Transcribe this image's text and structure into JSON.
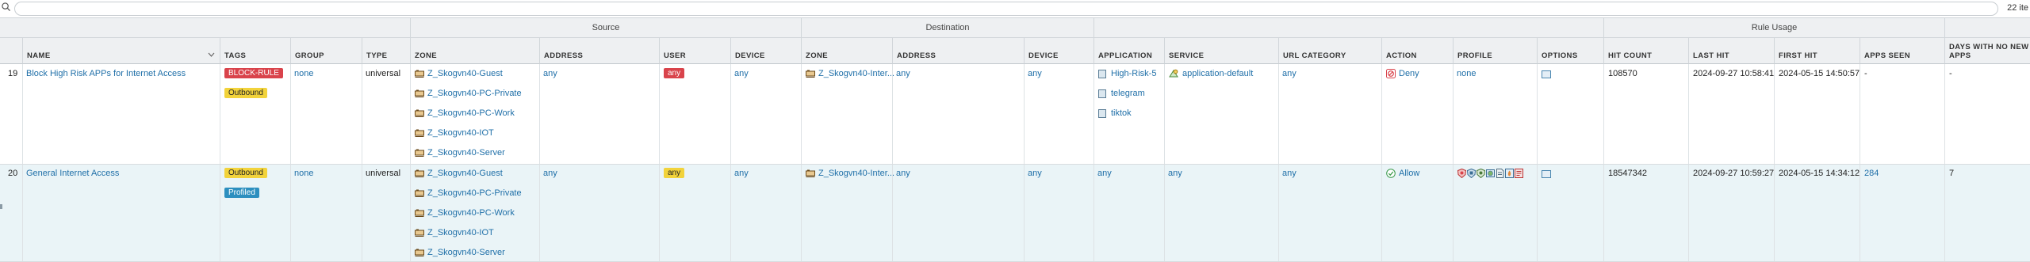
{
  "toolbar": {
    "search_value": "",
    "items_count": "22 ite"
  },
  "groups": {
    "source": "Source",
    "destination": "Destination",
    "rule_usage": "Rule Usage"
  },
  "columns": {
    "name": "Name",
    "tags": "Tags",
    "group": "Group",
    "type": "Type",
    "src_zone": "Zone",
    "src_address": "Address",
    "src_user": "User",
    "src_device": "Device",
    "dst_zone": "Zone",
    "dst_address": "Address",
    "dst_device": "Device",
    "application": "Application",
    "service": "Service",
    "url_category": "URL Category",
    "action": "Action",
    "profile": "Profile",
    "options": "Options",
    "hit_count": "Hit Count",
    "last_hit": "Last Hit",
    "first_hit": "First Hit",
    "apps_seen": "Apps Seen",
    "days_no_new_apps_1": "Days With No New",
    "days_no_new_apps_2": "Apps"
  },
  "rows": [
    {
      "num": "19",
      "name": "Block High Risk APPs for Internet Access",
      "tags": [
        "BLOCK-RULE",
        "Outbound"
      ],
      "group": "none",
      "type": "universal",
      "src_zones": [
        "Z_Skogvn40-Guest",
        "Z_Skogvn40-PC-Private",
        "Z_Skogvn40-PC-Work",
        "Z_Skogvn40-IOT",
        "Z_Skogvn40-Server"
      ],
      "src_address": "any",
      "src_user": "any",
      "src_device": "any",
      "dst_zone": "Z_Skogvn40-Inter...",
      "dst_address": "any",
      "dst_device": "any",
      "applications": [
        "High-Risk-5",
        "telegram",
        "tiktok"
      ],
      "service": "application-default",
      "url_category": "any",
      "action": "Deny",
      "profile": "none",
      "hit_count": "108570",
      "last_hit": "2024-09-27 10:58:41",
      "first_hit": "2024-05-15 14:50:57",
      "apps_seen": "-",
      "days_no_new": "-"
    },
    {
      "num": "20",
      "name": "General Internet Access",
      "tags": [
        "Outbound",
        "Profiled"
      ],
      "group": "none",
      "type": "universal",
      "src_zones": [
        "Z_Skogvn40-Guest",
        "Z_Skogvn40-PC-Private",
        "Z_Skogvn40-PC-Work",
        "Z_Skogvn40-IOT",
        "Z_Skogvn40-Server"
      ],
      "src_address": "any",
      "src_user": "any",
      "src_device": "any",
      "dst_zone": "Z_Skogvn40-Inter...",
      "dst_address": "any",
      "dst_device": "any",
      "application": "any",
      "service": "any",
      "url_category": "any",
      "action": "Allow",
      "profile_icons": [
        "antivirus-icon",
        "vulnerability-icon",
        "spyware-icon",
        "url-filtering-icon",
        "file-blocking-icon",
        "wildfire-icon",
        "data-filtering-icon"
      ],
      "hit_count": "18547342",
      "last_hit": "2024-09-27 10:59:27",
      "first_hit": "2024-05-15 14:34:12",
      "apps_seen": "284",
      "days_no_new": "7"
    }
  ],
  "colors": {
    "tag_block": "#d9434b",
    "tag_outbound": "#f2d33b",
    "tag_profiled": "#2d8fbf",
    "link": "#1f6fa8",
    "deny": "#d9434b",
    "allow": "#3a9a4a"
  }
}
